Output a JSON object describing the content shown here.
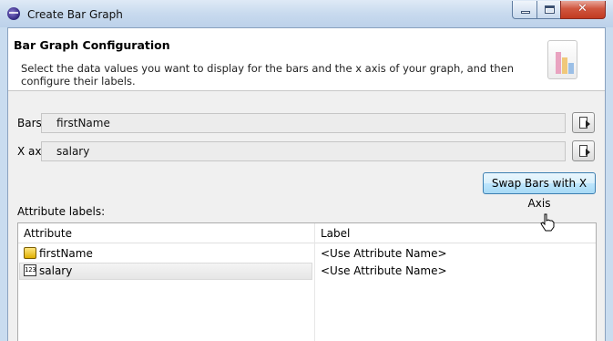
{
  "window": {
    "title": "Create Bar Graph",
    "close_symbol": "✕"
  },
  "header": {
    "title": "Bar Graph Configuration",
    "description": "Select the data values you want to display for the bars and the x axis of your graph, and then configure their labels."
  },
  "fields": {
    "bars_label": "Bars:",
    "bars_value": "firstName",
    "xaxis_label": "X axis:",
    "xaxis_value": "salary"
  },
  "swap_button_label": "Swap Bars with X Axis",
  "attribute_labels": {
    "label": "Attribute labels:",
    "columns": [
      "Attribute",
      "Label"
    ],
    "rows": [
      {
        "attribute": "firstName",
        "label": "<Use Attribute Name>",
        "icon": "string-attribute-icon"
      },
      {
        "attribute": "salary",
        "label": "<Use Attribute Name>",
        "icon": "numeric-attribute-icon",
        "icon_text": "123"
      }
    ]
  },
  "colors": {
    "swap_button_border": "#3c7fb1",
    "close_button": "#c23a21"
  }
}
